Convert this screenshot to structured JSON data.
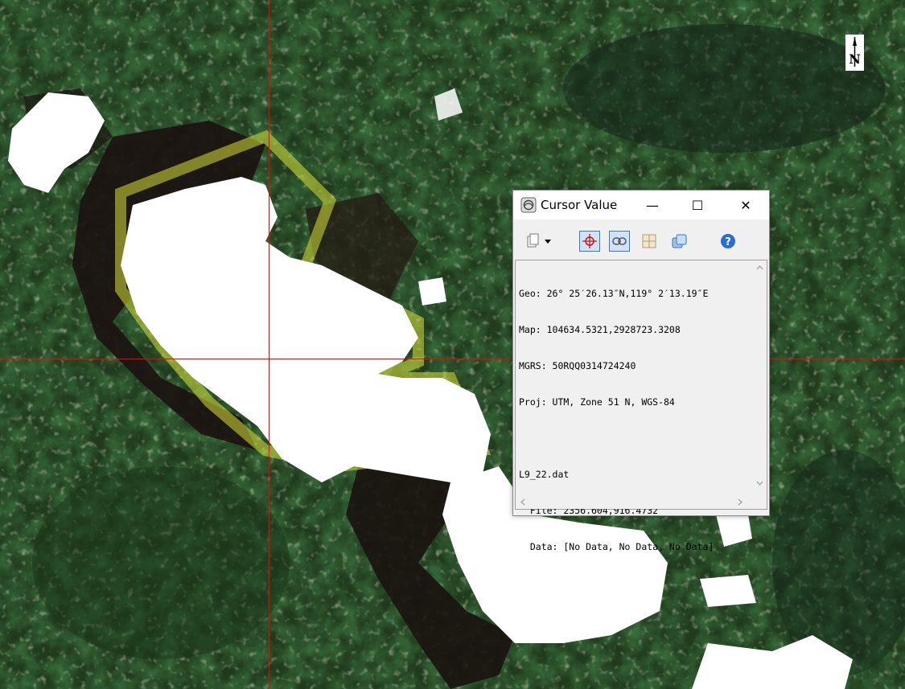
{
  "window": {
    "title": "Cursor Value",
    "minimize_glyph": "—",
    "maximize_glyph": "☐",
    "close_glyph": "✕"
  },
  "toolbar": {
    "icons": [
      "copy-icon",
      "dropdown-arrow-icon",
      "crosshair-icon",
      "link-icon",
      "grid-icon",
      "layers-icon",
      "help-icon"
    ]
  },
  "cursor_info": {
    "geo": "Geo: 26° 25′26.13″N,119° 2′13.19″E",
    "map": "Map: 104634.5321,2928723.3208",
    "mgrs": "MGRS: 50RQQ0314724240",
    "proj": "Proj: UTM, Zone 51 N, WGS-84",
    "file_name": "L9_22.dat",
    "file_coords": "  File: 2356.604,916.4732",
    "data_values": "  Data: [No Data, No Data, No Data]"
  },
  "north_arrow": {
    "label": "N"
  },
  "colors": {
    "crosshair": "#ff0000",
    "cloud": "#ffffff",
    "vegetation": "#2a4a22",
    "shadow": "#1a1410"
  }
}
